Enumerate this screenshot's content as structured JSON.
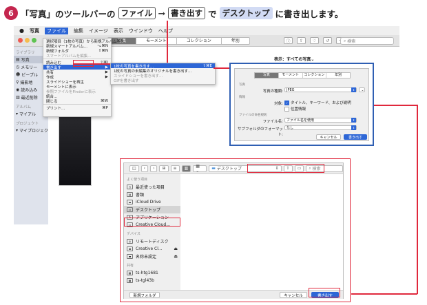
{
  "heading": {
    "step": "6",
    "part1": "「写真」のツールバーの",
    "btn1": "ファイル",
    "arrow": "→",
    "btn2": "書き出す",
    "part2": "で",
    "btn3": "デスクトップ",
    "part3": "に書き出します。"
  },
  "menubar": {
    "apple": "",
    "items": [
      "写真",
      "ファイル",
      "編集",
      "イメージ",
      "表示",
      "ウインドウ",
      "ヘルプ"
    ]
  },
  "toolbar": {
    "tabs": [
      "写真",
      "モーメント",
      "コレクション",
      "年別"
    ],
    "search_placeholder": "検索"
  },
  "sidebar": {
    "library_label": "ライブラリ",
    "items": [
      "写真",
      "メモリー",
      "ピープル",
      "撮影地",
      "読み込み",
      "最近削除"
    ],
    "album_label": "アルバム",
    "album_item": "マイアル",
    "project_label": "プロジェクト",
    "project_item": "マイプロジェクト"
  },
  "file_menu": [
    {
      "label": "選択項目（1枚の写真）から新規アルバム",
      "key": "⌘N"
    },
    {
      "label": "新規スマートアルバム...",
      "key": "⌥⌘N"
    },
    {
      "label": "新規フォルダ",
      "key": "⇧⌘N"
    },
    {
      "label": "スマートアルバムを編集...",
      "key": "",
      "disabled": true
    },
    {
      "sep": true
    },
    {
      "label": "読み込む",
      "key": "⇧⌘I"
    },
    {
      "label": "書き出す",
      "key": "▶",
      "highlight": true
    },
    {
      "label": "共有",
      "key": "▶"
    },
    {
      "label": "作成",
      "key": "▶"
    },
    {
      "label": "スライドショーを再生",
      "key": ""
    },
    {
      "label": "モーメントに表示",
      "key": ""
    },
    {
      "label": "参照ファイルをFinderに表示",
      "key": "",
      "disabled": true
    },
    {
      "label": "統合...",
      "key": ""
    },
    {
      "label": "閉じる",
      "key": "⌘W"
    },
    {
      "sep": true
    },
    {
      "label": "プリント...",
      "key": "⌘P"
    }
  ],
  "submenu": [
    {
      "label": "1枚の写真を書き出す...",
      "key": "⇧⌘E",
      "highlight": true
    },
    {
      "label": "1枚の写真の未編集のオリジナルを書き出す...",
      "key": ""
    },
    {
      "label": "スライドショーを書き出す...",
      "key": "",
      "disabled": true
    },
    {
      "label": "GIFを書き出す",
      "key": "",
      "disabled": true
    }
  ],
  "right_label": "表示：すべての写真",
  "export_dialog": {
    "tabs": [
      "写真",
      "モーメント",
      "コレクション",
      "年別"
    ],
    "sec_photo": "写真",
    "kind_label": "写真の種類:",
    "kind_value": "JPEG",
    "sec_info": "情報",
    "include_label": "対象:",
    "include_value": "タイトル、キーワード、および説明",
    "include_value2": "位置情報",
    "sec_file": "ファイルの命名規則",
    "filename_label": "ファイル名:",
    "filename_value": "ファイル名を使用",
    "subfolder_label": "サブフォルダのフォーマット:",
    "subfolder_value": "なし",
    "cancel": "キャンセル",
    "export": "書き出す"
  },
  "save_dialog": {
    "location": "デスクトップ",
    "search_placeholder": "検索",
    "sec_favorites": "よく使う項目",
    "favorites": [
      {
        "icon": "clock-icon",
        "glyph": "◷",
        "label": "最近使った項目"
      },
      {
        "icon": "document-icon",
        "glyph": "▤",
        "label": "書類"
      },
      {
        "icon": "cloud-icon",
        "glyph": "☁",
        "label": "iCloud Drive"
      },
      {
        "icon": "desktop-icon",
        "glyph": "▭",
        "label": "デスクトップ",
        "selected": true
      },
      {
        "icon": "applications-icon",
        "glyph": "A",
        "label": "アプリケーション"
      },
      {
        "icon": "folder-icon",
        "glyph": "▭",
        "label": "Creative Cloud..."
      }
    ],
    "sec_devices": "デバイス",
    "devices": [
      {
        "icon": "remote-disk-icon",
        "glyph": "◎",
        "label": "リモートディスク"
      },
      {
        "icon": "drive-icon",
        "glyph": "▬",
        "label": "Creative Cl...",
        "eject": "⏏"
      },
      {
        "icon": "drive-icon",
        "glyph": "▬",
        "label": "名称未設定",
        "eject": "⏏"
      }
    ],
    "sec_shared": "共有",
    "shared": [
      {
        "icon": "computer-icon",
        "glyph": "▦",
        "label": "ts-htg1681"
      },
      {
        "icon": "computer-icon",
        "glyph": "▦",
        "label": "ts-tgl43b"
      }
    ],
    "new_folder": "新規フォルダ",
    "cancel": "キャンセル",
    "export": "書き出す"
  },
  "colors": {
    "accent": "#2d66d6",
    "annotation_red": "#e0283c",
    "step_badge": "#c4264e",
    "dialog_border": "#2f5fb3"
  }
}
